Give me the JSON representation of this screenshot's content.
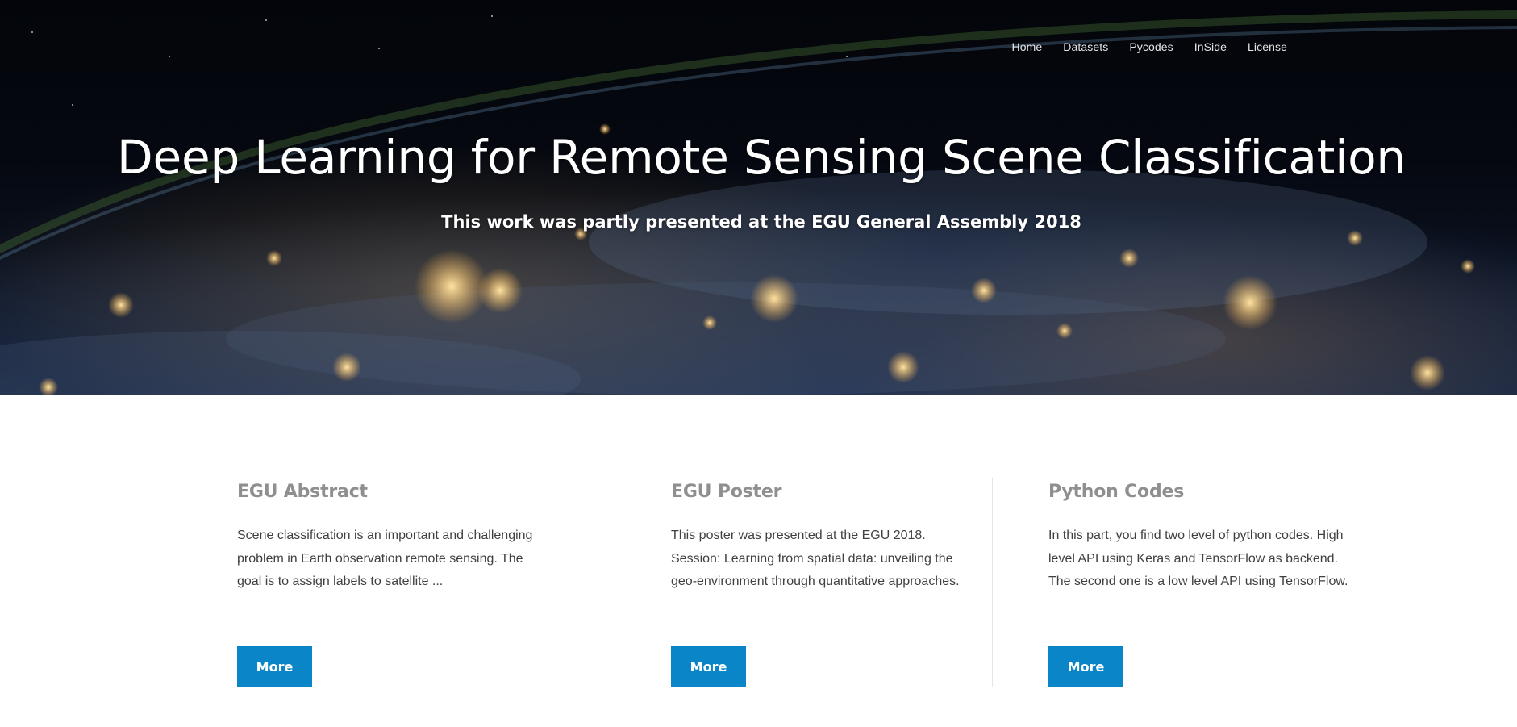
{
  "nav": {
    "items": [
      {
        "label": "Home"
      },
      {
        "label": "Datasets"
      },
      {
        "label": "Pycodes"
      },
      {
        "label": "InSide"
      },
      {
        "label": "License"
      }
    ]
  },
  "hero": {
    "title": "Deep Learning for Remote Sensing Scene Classification",
    "subtitle": "This work was partly presented at the EGU General Assembly 2018"
  },
  "features": [
    {
      "title": "EGU Abstract",
      "text": "Scene classification is an important and challenging problem in Earth observation remote sensing. The goal is to assign labels to satellite ...",
      "button": "More"
    },
    {
      "title": "EGU Poster",
      "text": "This poster was presented at the EGU 2018. Session: Learning from spatial data: unveiling the geo-environment through quantitative approaches.",
      "button": "More"
    },
    {
      "title": "Python Codes",
      "text": "In this part, you find two level of python codes. High level API using Keras and TensorFlow as backend. The second one is a low level API using TensorFlow.",
      "button": "More"
    }
  ],
  "colors": {
    "button": "#0a86c8",
    "feature_title": "#8f8f8f",
    "body_text": "#404040"
  }
}
